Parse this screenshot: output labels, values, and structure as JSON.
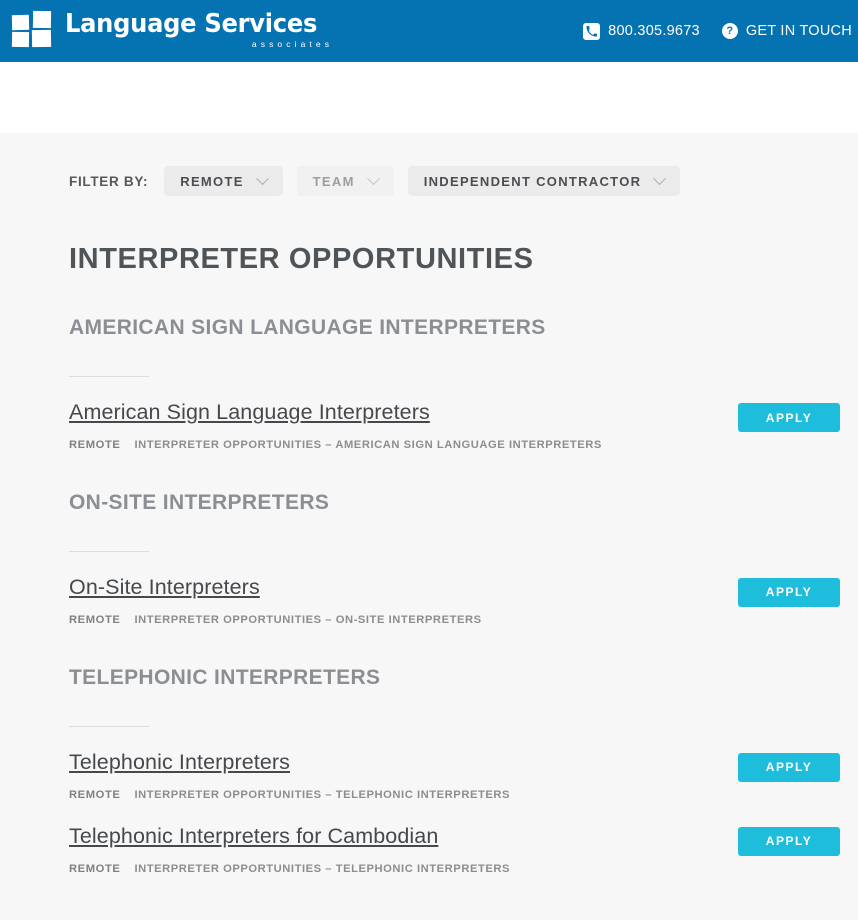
{
  "header": {
    "brand": {
      "logo_icon": "four-squares-logo-icon",
      "name": "Language Services",
      "tagline": "associates"
    },
    "phone": {
      "icon": "phone-icon",
      "label": "800.305.9673"
    },
    "get_in_touch": {
      "icon": "question-mark-icon",
      "label": "GET IN TOUCH"
    },
    "brand_color": "#0572B1"
  },
  "filters": {
    "label": "FILTER BY:",
    "items": [
      {
        "label": "REMOTE",
        "muted": false
      },
      {
        "label": "TEAM",
        "muted": true
      },
      {
        "label": "INDEPENDENT CONTRACTOR",
        "muted": false
      }
    ]
  },
  "main": {
    "page_title": "INTERPRETER OPPORTUNITIES",
    "apply_label": "APPLY",
    "accent_color": "#1EBDDC",
    "sections": [
      {
        "title": "AMERICAN SIGN LANGUAGE INTERPRETERS",
        "jobs": [
          {
            "title": "American Sign Language Interpreters",
            "location": "REMOTE",
            "department": "INTERPRETER OPPORTUNITIES – AMERICAN SIGN LANGUAGE INTERPRETERS"
          }
        ]
      },
      {
        "title": "ON-SITE INTERPRETERS",
        "jobs": [
          {
            "title": "On-Site Interpreters",
            "location": "REMOTE",
            "department": "INTERPRETER OPPORTUNITIES – ON-SITE INTERPRETERS"
          }
        ]
      },
      {
        "title": "TELEPHONIC INTERPRETERS",
        "jobs": [
          {
            "title": "Telephonic Interpreters",
            "location": "REMOTE",
            "department": "INTERPRETER OPPORTUNITIES – TELEPHONIC INTERPRETERS"
          },
          {
            "title": "Telephonic Interpreters for Cambodian",
            "location": "REMOTE",
            "department": "INTERPRETER OPPORTUNITIES – TELEPHONIC INTERPRETERS"
          }
        ]
      }
    ]
  }
}
